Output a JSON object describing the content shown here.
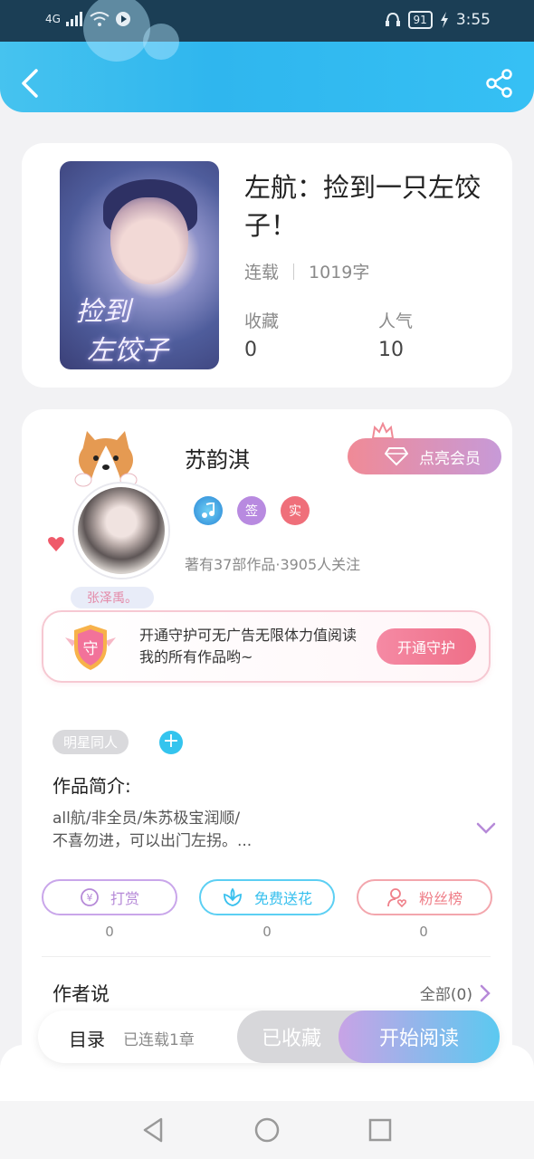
{
  "status_bar": {
    "signal": "4G",
    "battery": "91",
    "time": "3:55"
  },
  "colors": {
    "header_accent": "#36c0f4",
    "vip_gradient_start": "#f08a96",
    "vip_gradient_end": "#c79ad8",
    "guard_button": "#ef6f88",
    "tag_add": "#34c4ee",
    "read_gradient_start": "#c8a3e6",
    "read_gradient_end": "#5bc9f0"
  },
  "header": {
    "back_icon": "chevron-left-icon",
    "share_icon": "share-icon"
  },
  "book": {
    "cover_text_line1": "捡到",
    "cover_text_line2": "左饺子",
    "title": "左航：捡到一只左饺子！",
    "status": "连载",
    "word_count": "1019字",
    "favorites_label": "收藏",
    "favorites_value": "0",
    "popularity_label": "人气",
    "popularity_value": "10"
  },
  "author": {
    "avatar_tag": "张泽禹。",
    "name": "苏韵淇",
    "vip_button": "点亮会员",
    "badges": [
      "签",
      "实"
    ],
    "summary": "著有37部作品·3905人关注"
  },
  "guard": {
    "icon_text": "守",
    "description": "开通守护可无广告无限体力值阅读我的所有作品哟~",
    "button": "开通守护"
  },
  "tags": {
    "items": [
      "明星同人"
    ],
    "add_symbol": "+"
  },
  "intro": {
    "title": "作品简介:",
    "text_line1": "all航/非全员/朱苏极宝润顺/",
    "text_line2": "不喜勿进，可以出门左拐。..."
  },
  "actions": [
    {
      "label": "打赏",
      "count": "0",
      "icon": "coin-icon"
    },
    {
      "label": "免费送花",
      "count": "0",
      "icon": "flower-icon"
    },
    {
      "label": "粉丝榜",
      "count": "0",
      "icon": "fans-icon"
    }
  ],
  "author_says": {
    "title": "作者说",
    "all_link": "全部(0)"
  },
  "bottom_bar": {
    "toc_label": "目录",
    "toc_sub": "已连载1章",
    "collected_button": "已收藏",
    "read_button": "开始阅读"
  },
  "nav": {
    "back_icon": "triangle-back-icon",
    "home_icon": "circle-home-icon",
    "recents_icon": "square-recents-icon"
  }
}
